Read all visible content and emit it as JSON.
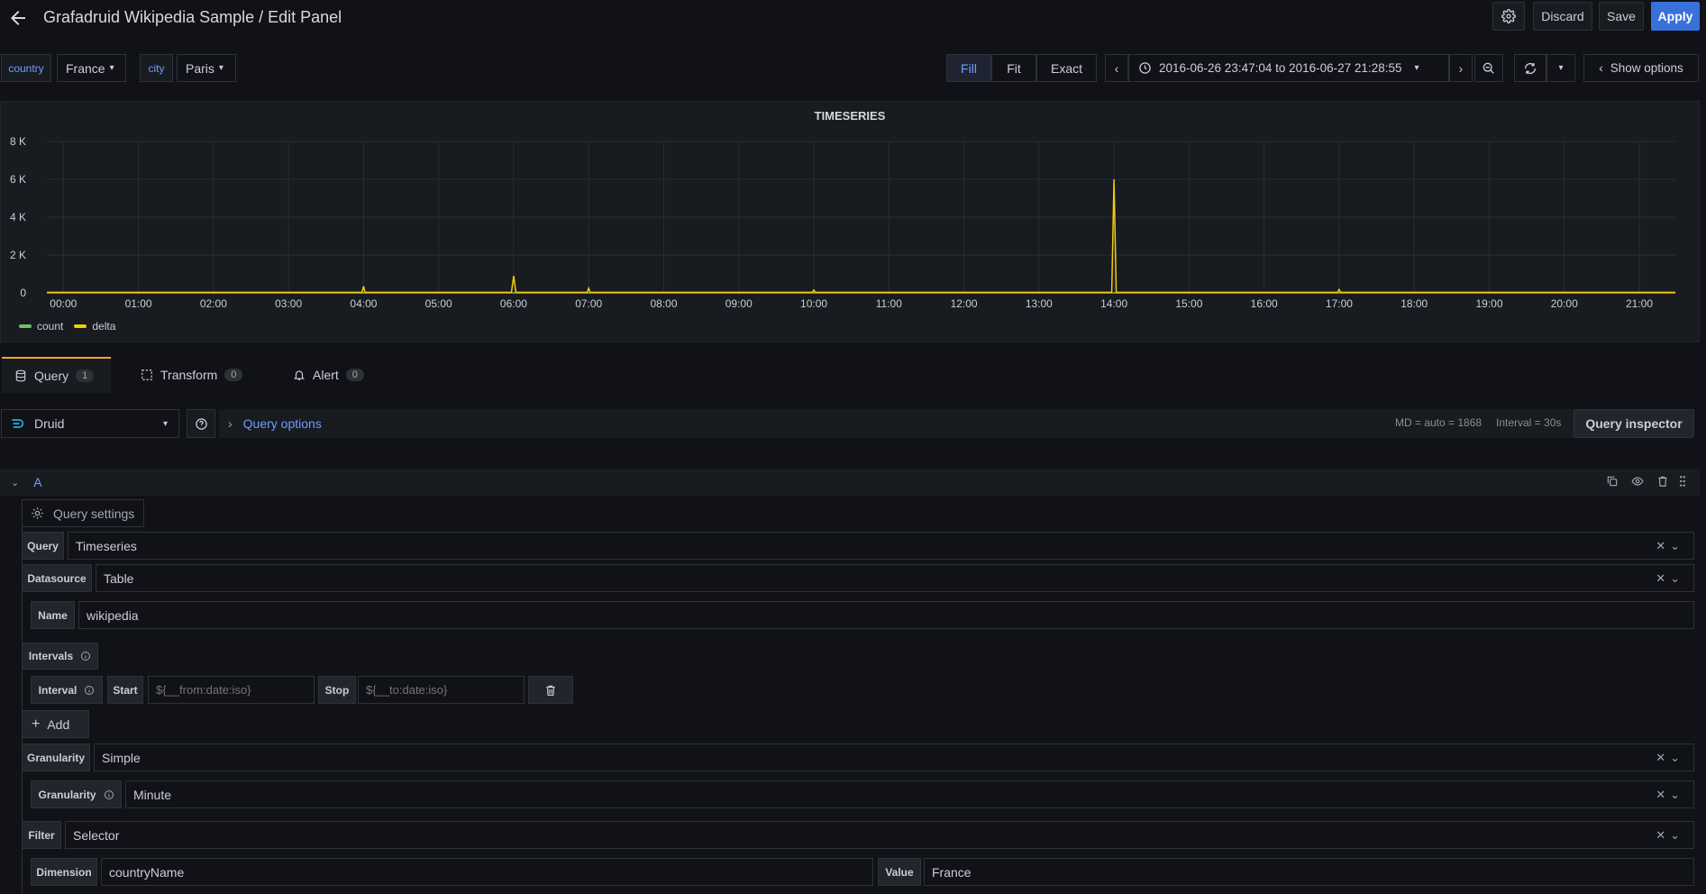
{
  "header": {
    "title": "Grafadruid Wikipedia Sample / Edit Panel",
    "discard_label": "Discard",
    "save_label": "Save",
    "apply_label": "Apply"
  },
  "variables": [
    {
      "label": "country",
      "value": "France"
    },
    {
      "label": "city",
      "value": "Paris"
    }
  ],
  "toolbar": {
    "fill_label": "Fill",
    "fit_label": "Fit",
    "exact_label": "Exact",
    "time_range": "2016-06-26 23:47:04 to 2016-06-27 21:28:55",
    "show_options_label": "Show options"
  },
  "panel": {
    "title": "TIMESERIES"
  },
  "chart_data": {
    "type": "line",
    "title": "TIMESERIES",
    "y_ticks": [
      "8 K",
      "6 K",
      "4 K",
      "2 K",
      "0"
    ],
    "ylim": [
      0,
      8000
    ],
    "x_ticks": [
      "00:00",
      "01:00",
      "02:00",
      "03:00",
      "04:00",
      "05:00",
      "06:00",
      "07:00",
      "08:00",
      "09:00",
      "10:00",
      "11:00",
      "12:00",
      "13:00",
      "14:00",
      "15:00",
      "16:00",
      "17:00",
      "18:00",
      "19:00",
      "20:00",
      "21:00"
    ],
    "xlim": [
      -0.22,
      21.48
    ],
    "grid": true,
    "legend": "bottom-left",
    "series": [
      {
        "name": "count",
        "color": "#73bf69",
        "points": [
          [
            -0.22,
            0
          ],
          [
            21.48,
            0
          ]
        ]
      },
      {
        "name": "delta",
        "color": "#f2cc0c",
        "points": [
          [
            -0.22,
            30
          ],
          [
            3.98,
            30
          ],
          [
            4.0,
            350
          ],
          [
            4.02,
            30
          ],
          [
            5.97,
            30
          ],
          [
            6.0,
            900
          ],
          [
            6.03,
            30
          ],
          [
            6.98,
            30
          ],
          [
            7.0,
            250
          ],
          [
            7.02,
            30
          ],
          [
            9.98,
            30
          ],
          [
            10.0,
            150
          ],
          [
            10.02,
            30
          ],
          [
            13.97,
            30
          ],
          [
            14.0,
            6000
          ],
          [
            14.03,
            30
          ],
          [
            16.98,
            30
          ],
          [
            17.0,
            180
          ],
          [
            17.02,
            30
          ],
          [
            21.48,
            30
          ]
        ]
      }
    ]
  },
  "tabs": [
    {
      "label": "Query",
      "count": "1"
    },
    {
      "label": "Transform",
      "count": "0"
    },
    {
      "label": "Alert",
      "count": "0"
    }
  ],
  "query_row": {
    "datasource": "Druid",
    "query_options_label": "Query options",
    "md_info": "MD = auto = 1868",
    "interval_info": "Interval = 30s",
    "query_inspector_label": "Query inspector"
  },
  "query_a": {
    "ref": "A",
    "settings_label": "Query settings",
    "query_label": "Query",
    "query_value": "Timeseries",
    "datasource_label": "Datasource",
    "datasource_value": "Table",
    "name_label": "Name",
    "name_value": "wikipedia",
    "intervals_label": "Intervals",
    "interval_label": "Interval",
    "start_label": "Start",
    "start_placeholder": "${__from:date:iso}",
    "stop_label": "Stop",
    "stop_placeholder": "${__to:date:iso}",
    "add_label": "Add",
    "granularity_label": "Granularity",
    "granularity_value": "Simple",
    "granularity2_label": "Granularity",
    "granularity2_value": "Minute",
    "filter_label": "Filter",
    "filter_value": "Selector",
    "dimension_label": "Dimension",
    "dimension_value": "countryName",
    "value_label": "Value",
    "value_value": "France"
  }
}
